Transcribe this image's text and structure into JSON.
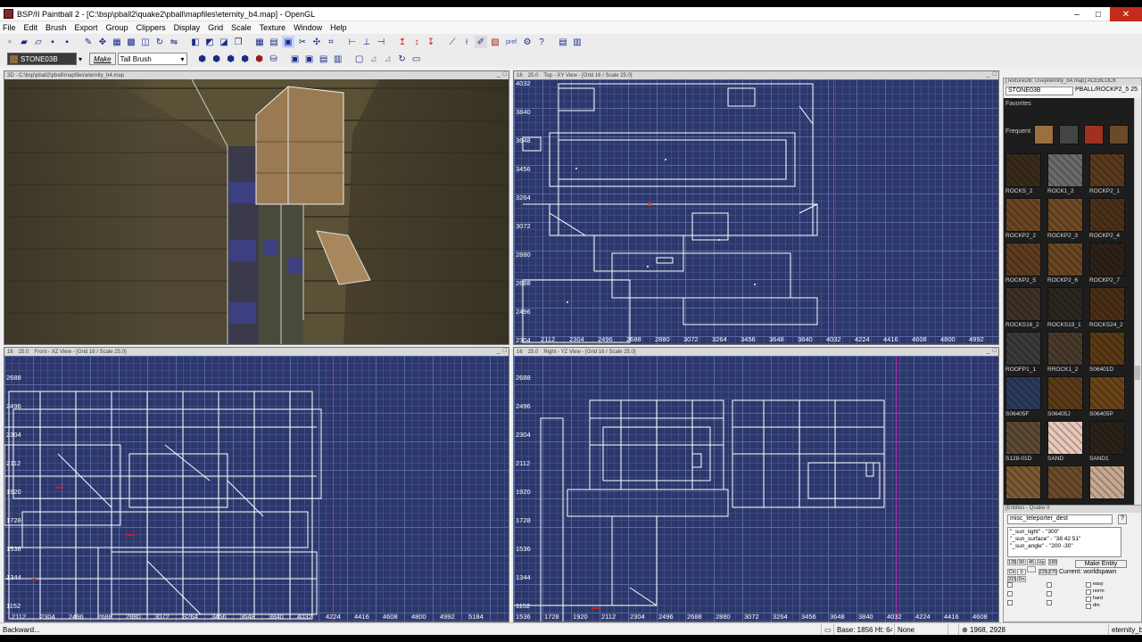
{
  "window": {
    "title": "BSP/II Paintball 2 - [C:\\bsp\\pball2\\quake2\\pball\\mapfiles\\eternity_b4.map] - OpenGL",
    "controls": {
      "minimize": "–",
      "maximize": "□",
      "close": "✕"
    }
  },
  "menu": [
    "File",
    "Edit",
    "Brush",
    "Export",
    "Group",
    "Clippers",
    "Display",
    "Grid",
    "Scale",
    "Texture",
    "Window",
    "Help"
  ],
  "toolbar": {
    "texture_name": "STONE03B",
    "make_label": "Make",
    "brush_type": "Tall Brush",
    "pref_label": "pref"
  },
  "view3d": {
    "header": "3D - C:\\bsp\\pball2\\pball\\mapfiles\\eternity_b4.map"
  },
  "top_view": {
    "grid": "16",
    "scale": "25.0",
    "header": "Top - XY View - [Grid 16 / Scale 25.0]",
    "y_labels": [
      "4032",
      "3840",
      "3648",
      "3456",
      "3264",
      "3072",
      "2880",
      "2688",
      "2496",
      "2304"
    ],
    "x_labels": [
      "2112",
      "2304",
      "2496",
      "2688",
      "2880",
      "3072",
      "3264",
      "3456",
      "3648",
      "3840",
      "4032",
      "4224",
      "4416",
      "4608",
      "4800",
      "4992"
    ]
  },
  "front_view": {
    "grid": "16",
    "scale": "25.0",
    "header": "Front - XZ View - [Grid 16 / Scale 25.0]",
    "y_labels": [
      "2688",
      "2496",
      "2304",
      "2112",
      "1920",
      "1728",
      "1536",
      "1344",
      "1152"
    ],
    "x_labels": [
      "2112",
      "2304",
      "2496",
      "2688",
      "2880",
      "3072",
      "3264",
      "3456",
      "3648",
      "3840",
      "4032",
      "4224",
      "4416",
      "4608",
      "4800",
      "4992",
      "5184"
    ]
  },
  "right_view": {
    "grid": "16",
    "scale": "25.0",
    "header": "Right - YZ View - [Grid 16 / Scale 25.0]",
    "y_labels": [
      "2688",
      "2496",
      "2304",
      "2112",
      "1920",
      "1728",
      "1536",
      "1344",
      "1152"
    ],
    "x_labels": [
      "1536",
      "1728",
      "1920",
      "2112",
      "2304",
      "2496",
      "2688",
      "2880",
      "3072",
      "3264",
      "3456",
      "3648",
      "3840",
      "4032",
      "4224",
      "4416",
      "4608"
    ]
  },
  "texture_panel": {
    "header": "[TextureDB: Use[eternity_b4.map]:ACEBLOCK",
    "selected": "STONE03B",
    "path": "PBALL/ROCKP2_5 25",
    "favorites_label": "Favorites",
    "frequent_label": "Frequent",
    "textures": [
      {
        "name": "ROCKS_2",
        "color": "#3a2a1c"
      },
      {
        "name": "ROCK1_2",
        "color": "#6a6a6a"
      },
      {
        "name": "ROCKP2_1",
        "color": "#5a3a1e"
      },
      {
        "name": "ROCKP2_2",
        "color": "#6b4522"
      },
      {
        "name": "ROCKP2_3",
        "color": "#704a25"
      },
      {
        "name": "ROCKP2_4",
        "color": "#4b3019"
      },
      {
        "name": "ROCKP2_5",
        "color": "#5e3b1f"
      },
      {
        "name": "ROCKP2_6",
        "color": "#6a4624"
      },
      {
        "name": "ROCKP2_7",
        "color": "#2e2118"
      },
      {
        "name": "ROCKS16_2",
        "color": "#3d3228"
      },
      {
        "name": "ROCKS19_1",
        "color": "#2a2620"
      },
      {
        "name": "ROCKS24_2",
        "color": "#4a2f16"
      },
      {
        "name": "ROOFP1_1",
        "color": "#3a3a3a"
      },
      {
        "name": "RROCK1_2",
        "color": "#4a3a2c"
      },
      {
        "name": "S06401D",
        "color": "#5a3a14"
      },
      {
        "name": "S06405F",
        "color": "#2c3a5a"
      },
      {
        "name": "S06405J",
        "color": "#5c3a18"
      },
      {
        "name": "S06405P",
        "color": "#6a4418"
      },
      {
        "name": "S128-01D",
        "color": "#5c4a32"
      },
      {
        "name": "SAND",
        "color": "#e8c8b8"
      },
      {
        "name": "SAND1",
        "color": "#2a2218"
      },
      {
        "name": "",
        "color": "#7a5a32"
      },
      {
        "name": "",
        "color": "#6a4a2a"
      },
      {
        "name": "",
        "color": "#c8a890"
      }
    ],
    "frequent": [
      "#9a7040",
      "#444444",
      "#a03020",
      "#6a4a2a"
    ]
  },
  "entity_panel": {
    "header": "[Entities - Quake II",
    "class": "misc_teleporter_dest",
    "help": "?",
    "properties": [
      "\"_sun_light\" - \"300\"",
      "\"_sun_surface\" - \"38 42 51\"",
      "\"_sun_angle\" - \"200 -30\""
    ],
    "angles": [
      "135",
      "90",
      "45",
      "Up",
      "180",
      "Clr",
      "0",
      "",
      "225",
      "270",
      "315",
      "Dn"
    ],
    "make_label": "Make Entity",
    "current_label": "Current:",
    "current_value": "worldspawn",
    "flags": [
      "easy",
      "norm",
      "hard",
      "dm"
    ]
  },
  "status": {
    "left": "Backward...",
    "base": "Base: 1856 Ht: 640",
    "none": "None",
    "coords": "1968, 2928",
    "file": "eternity_b4"
  }
}
